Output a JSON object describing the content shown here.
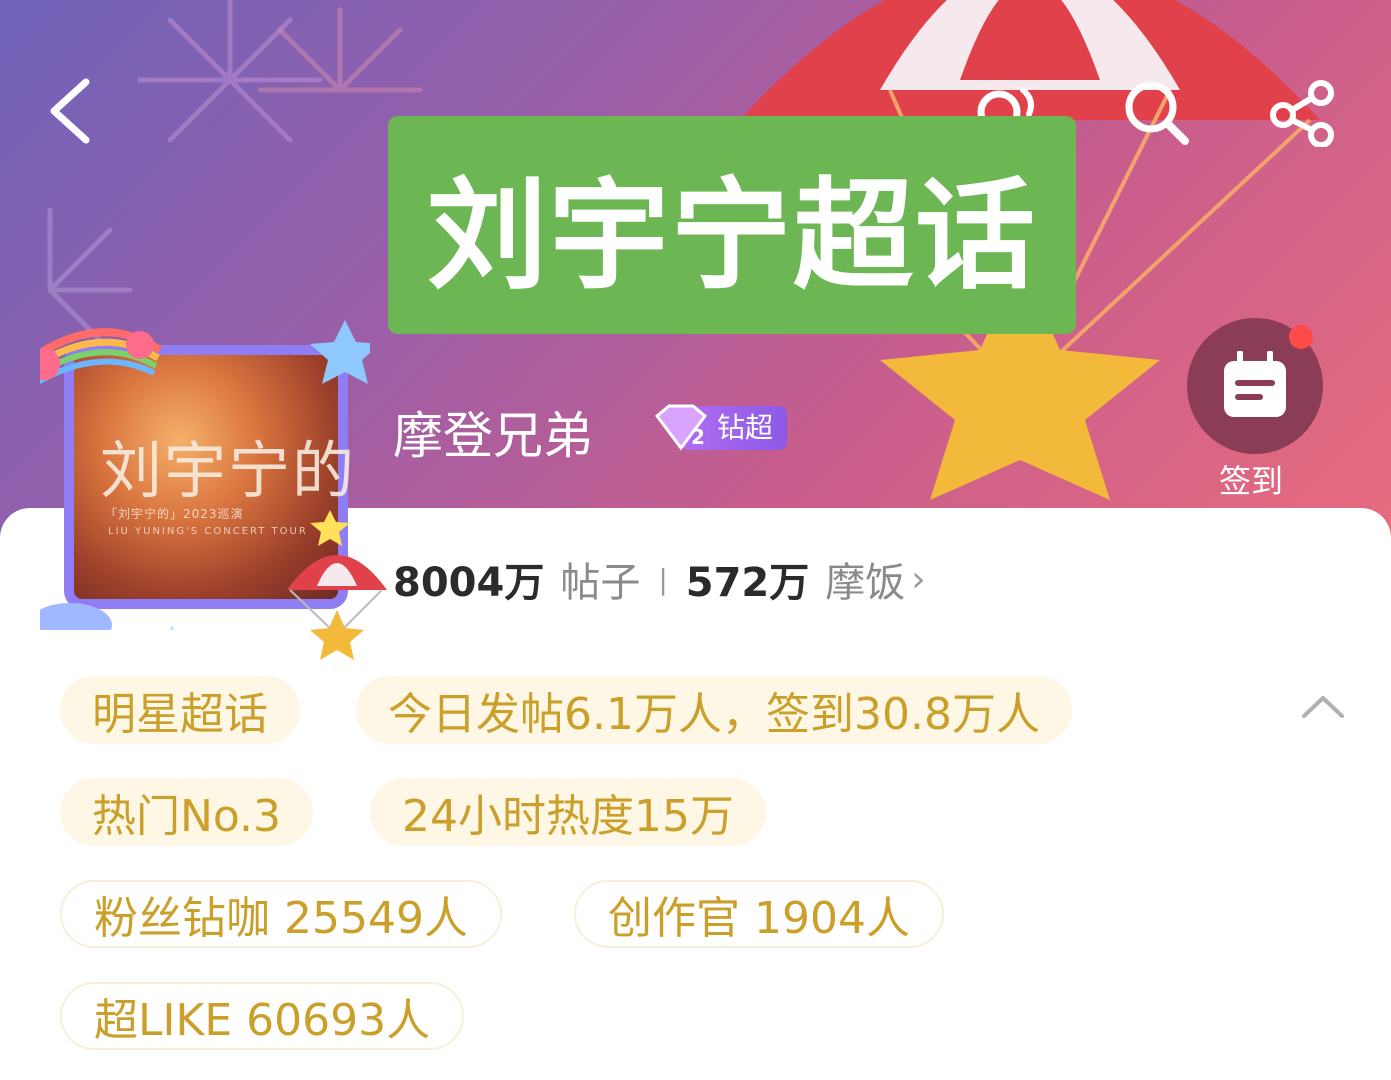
{
  "header": {
    "title": "刘宇宁超话",
    "back_icon": "back-arrow-icon",
    "icons": [
      "user-follow-icon",
      "search-icon",
      "share-icon"
    ]
  },
  "profile": {
    "avatar_text": "刘宇宁的",
    "avatar_subtitle": "「刘宇宁的」2023巡演",
    "avatar_subtitle2": "LIU YUNING'S CONCERT TOUR",
    "name": "摩登兄弟",
    "badge_level": "2",
    "badge_label": "钻超"
  },
  "checkin": {
    "label": "签到",
    "icon": "calendar-icon"
  },
  "stats": {
    "posts_value": "8004万",
    "posts_label": "帖子",
    "fans_value": "572万",
    "fans_label": "摩饭"
  },
  "tags": [
    {
      "text": "明星超话",
      "style": "filled"
    },
    {
      "text": "今日发帖6.1万人，签到30.8万人",
      "style": "filled"
    },
    {
      "text": "热门No.3",
      "style": "filled"
    },
    {
      "text": "24小时热度15万",
      "style": "filled"
    },
    {
      "text": "粉丝钻咖 25549人",
      "style": "outlined"
    },
    {
      "text": "创作官 1904人",
      "style": "outlined"
    },
    {
      "text": "超LIKE 60693人",
      "style": "outlined"
    }
  ],
  "colors": {
    "title_bg": "#6db654",
    "tag_text": "#caa02a",
    "tag_bg": "#fff7e6",
    "badge": "#b16df2"
  }
}
